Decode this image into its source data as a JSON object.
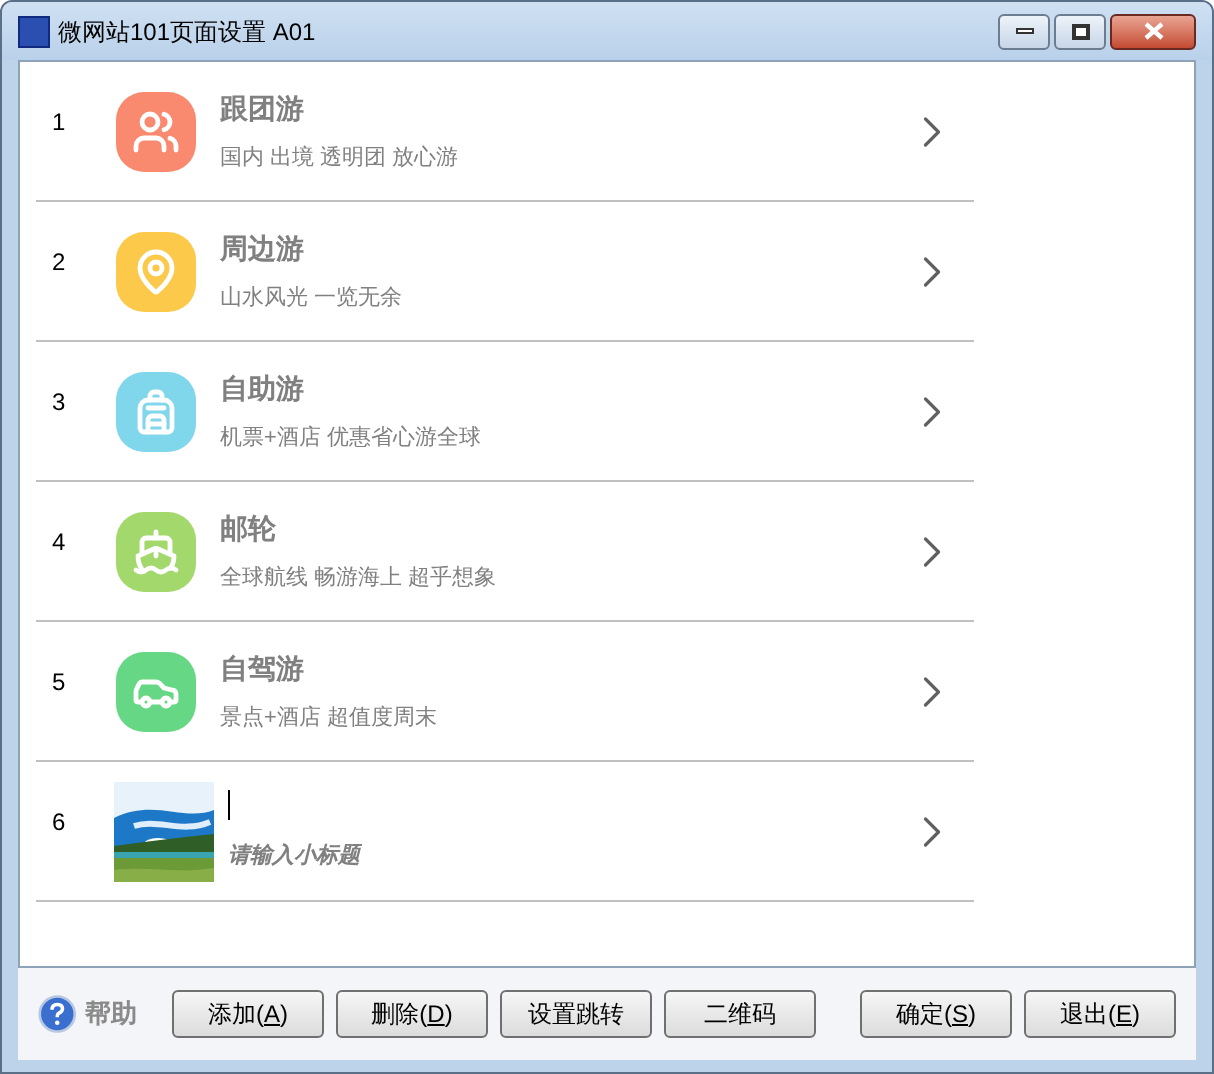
{
  "window": {
    "title": "微网站101页面设置 A01"
  },
  "items": [
    {
      "kind": "icon",
      "number": "1",
      "title": "跟团游",
      "subtitle": "国内 出境 透明团 放心游",
      "color": "#f98a70"
    },
    {
      "kind": "icon",
      "number": "2",
      "title": "周边游",
      "subtitle": "山水风光 一览无余",
      "color": "#fcc94a"
    },
    {
      "kind": "icon",
      "number": "3",
      "title": "自助游",
      "subtitle": "机票+酒店 优惠省心游全球",
      "color": "#80d6ea"
    },
    {
      "kind": "icon",
      "number": "4",
      "title": "邮轮",
      "subtitle": "全球航线 畅游海上 超乎想象",
      "color": "#a2d86c"
    },
    {
      "kind": "icon",
      "number": "5",
      "title": "自驾游",
      "subtitle": "景点+酒店 超值度周末",
      "color": "#66d784"
    },
    {
      "kind": "picture",
      "number": "6",
      "placeholder": "请输入小标题"
    }
  ],
  "help": "帮助",
  "buttons": [
    {
      "prefix": "添加(",
      "key": "A",
      "suffix": ")"
    },
    {
      "prefix": "删除(",
      "key": "D",
      "suffix": ")"
    },
    {
      "prefix": "设置跳转"
    },
    {
      "prefix": "二维码"
    },
    {
      "prefix": "确定(",
      "key": "S",
      "suffix": ")"
    },
    {
      "prefix": "退出(",
      "key": "E",
      "suffix": ")"
    }
  ]
}
